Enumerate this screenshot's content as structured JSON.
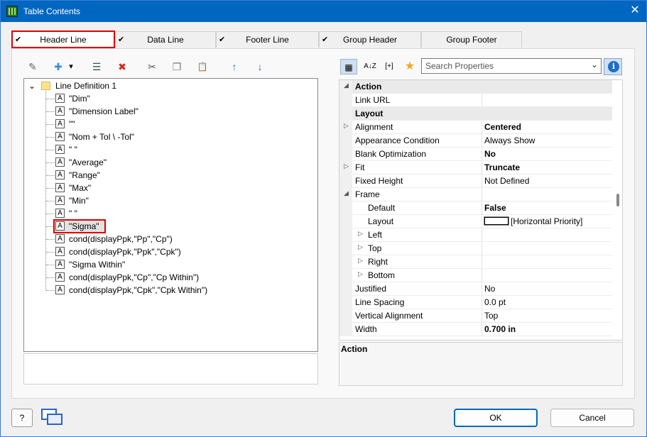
{
  "window": {
    "title": "Table Contents",
    "close_glyph": "✕"
  },
  "tabs": [
    {
      "label": "Header Line",
      "checked": true,
      "active": true
    },
    {
      "label": "Data Line",
      "checked": true
    },
    {
      "label": "Footer Line",
      "checked": true
    },
    {
      "label": "Group Header",
      "checked": true
    },
    {
      "label": "Group Footer",
      "checked": false
    }
  ],
  "check_glyph": "✔",
  "left_toolbar": {
    "icons": [
      "wand-icon",
      "new-item-icon",
      "dropdown-arrow-icon",
      "properties-icon",
      "delete-icon",
      "cut-icon",
      "copy-icon",
      "paste-icon",
      "move-up-icon",
      "move-down-icon"
    ],
    "glyphs": {
      "wand": "✎",
      "new": "✚",
      "dropdown": "▾",
      "props": "☰",
      "delete": "✖",
      "cut": "✂",
      "copy": "❐",
      "paste": "📋",
      "up": "↑",
      "down": "↓"
    }
  },
  "tree": {
    "root_label": "Line Definition  1",
    "expander": "⌄",
    "item_icon_letter": "A",
    "items": [
      "\"Dim\"",
      "\"Dimension Label\"",
      "\"\"",
      "\"Nom    + Tol \\ -Tol\"",
      "\" \"",
      "\"Average\"",
      "\"Range\"",
      "\"Max\"",
      "\"Min\"",
      "\" \"",
      "\"Sigma\"",
      "cond(displayPpk,\"Pp\",\"Cp\")",
      "cond(displayPpk,\"Ppk\",\"Cpk\")",
      "\"Sigma Within\"",
      "cond(displayPpk,\"Cp\",\"Cp Within\")",
      "cond(displayPpk,\"Cpk\",\"Cpk Within\")"
    ],
    "selected_index": 10
  },
  "right_toolbar": {
    "categorized_glyph": "▦",
    "sort_glyph": "A↓Z",
    "expand_glyph": "[+]",
    "favorite_glyph": "★",
    "search_placeholder": "Search Properties",
    "search_chevron": "⌄",
    "info_glyph": "i"
  },
  "properties": [
    {
      "type": "cat",
      "name": "Action",
      "exp": "◢"
    },
    {
      "type": "prop",
      "name": "Link URL",
      "value": ""
    },
    {
      "type": "cat",
      "name": "Layout",
      "exp": ""
    },
    {
      "type": "prop",
      "name": "Alignment",
      "value": "Centered",
      "bold": true,
      "exp": "▷"
    },
    {
      "type": "prop",
      "name": "Appearance Condition",
      "value": "Always Show"
    },
    {
      "type": "prop",
      "name": "Blank Optimization",
      "value": "No",
      "bold": true
    },
    {
      "type": "prop",
      "name": "Fit",
      "value": "Truncate",
      "bold": true,
      "exp": "▷"
    },
    {
      "type": "prop",
      "name": "Fixed Height",
      "value": "Not Defined"
    },
    {
      "type": "prop",
      "name": "Frame",
      "value": "",
      "exp": "◢"
    },
    {
      "type": "sub",
      "name": "Default",
      "value": "False",
      "bold": true
    },
    {
      "type": "sub",
      "name": "Layout",
      "value": "[Horizontal Priority]",
      "swatch": true
    },
    {
      "type": "sub",
      "name": "Left",
      "value": "",
      "exp": "▷"
    },
    {
      "type": "sub",
      "name": "Top",
      "value": "",
      "exp": "▷"
    },
    {
      "type": "sub",
      "name": "Right",
      "value": "",
      "exp": "▷"
    },
    {
      "type": "sub",
      "name": "Bottom",
      "value": "",
      "exp": "▷"
    },
    {
      "type": "prop",
      "name": "Justified",
      "value": "No"
    },
    {
      "type": "prop",
      "name": "Line Spacing",
      "value": "0.0 pt"
    },
    {
      "type": "prop",
      "name": "Vertical Alignment",
      "value": "Top"
    },
    {
      "type": "prop",
      "name": "Width",
      "value": "0.700 in",
      "bold": true
    }
  ],
  "description": {
    "title": "Action"
  },
  "footer": {
    "help_glyph": "?",
    "ok_label": "OK",
    "cancel_label": "Cancel"
  }
}
